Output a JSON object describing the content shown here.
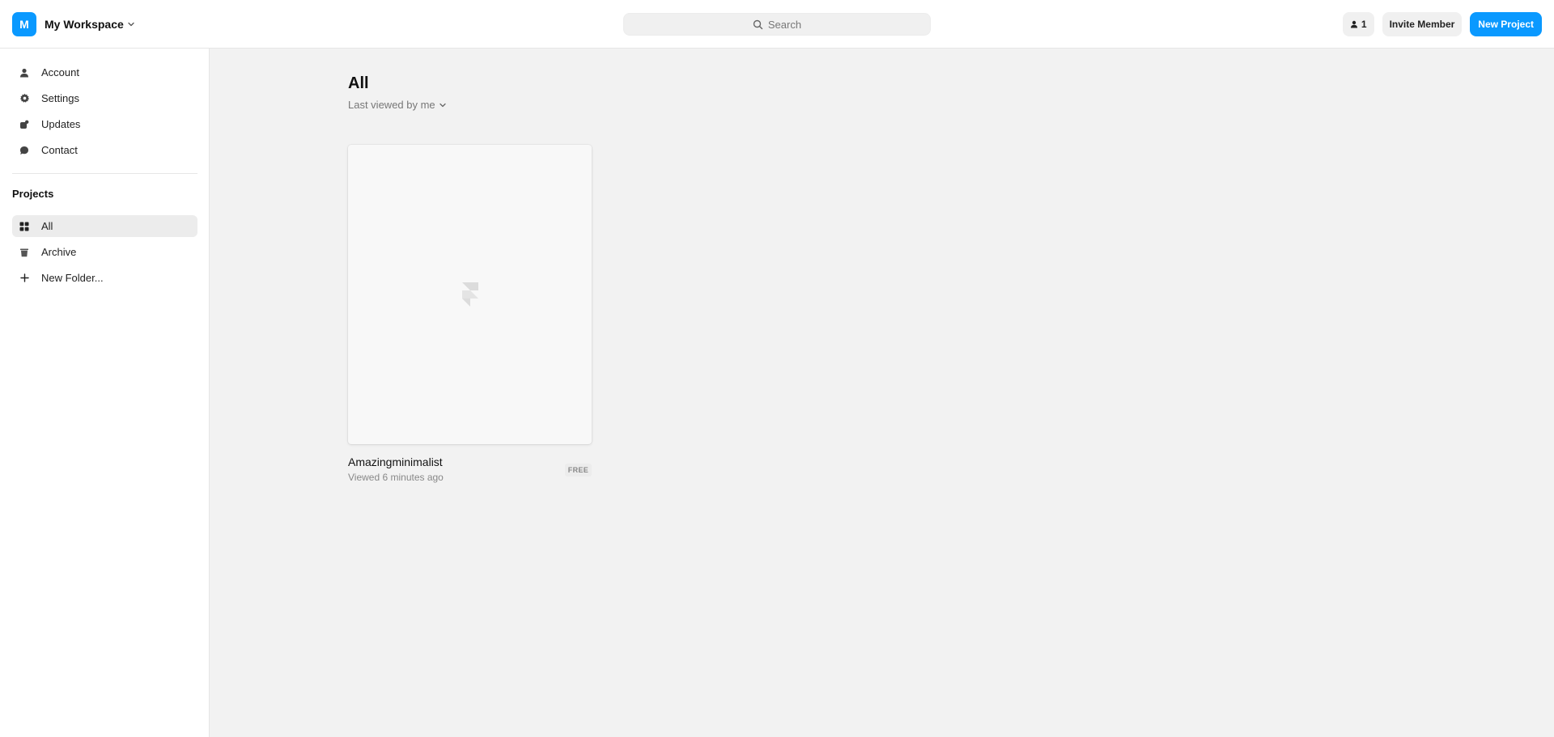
{
  "header": {
    "workspace": {
      "avatar_letter": "M",
      "name": "My Workspace",
      "chevron_icon": "chevron-down-icon"
    },
    "search": {
      "placeholder": "Search",
      "icon": "search-icon"
    },
    "members": {
      "icon": "user-icon",
      "count": "1"
    },
    "invite_label": "Invite Member",
    "new_project_label": "New Project"
  },
  "sidebar": {
    "nav": [
      {
        "label": "Account",
        "icon": "user-icon"
      },
      {
        "label": "Settings",
        "icon": "gear-icon"
      },
      {
        "label": "Updates",
        "icon": "updates-icon"
      },
      {
        "label": "Contact",
        "icon": "chat-icon"
      }
    ],
    "projects_title": "Projects",
    "projects": [
      {
        "label": "All",
        "icon": "grid-icon",
        "active": true
      },
      {
        "label": "Archive",
        "icon": "trash-icon",
        "active": false
      },
      {
        "label": "New Folder...",
        "icon": "plus-icon",
        "active": false
      }
    ]
  },
  "main": {
    "title": "All",
    "sort_label": "Last viewed by me",
    "projects": [
      {
        "name": "Amazingminimalist",
        "subtitle": "Viewed 6 minutes ago",
        "badge": "FREE",
        "thumb_icon": "framer-logo-icon"
      }
    ]
  },
  "colors": {
    "accent": "#0a99ff",
    "sidebar_bg": "#ffffff",
    "main_bg": "#f2f2f2",
    "active_item_bg": "#ececec"
  }
}
